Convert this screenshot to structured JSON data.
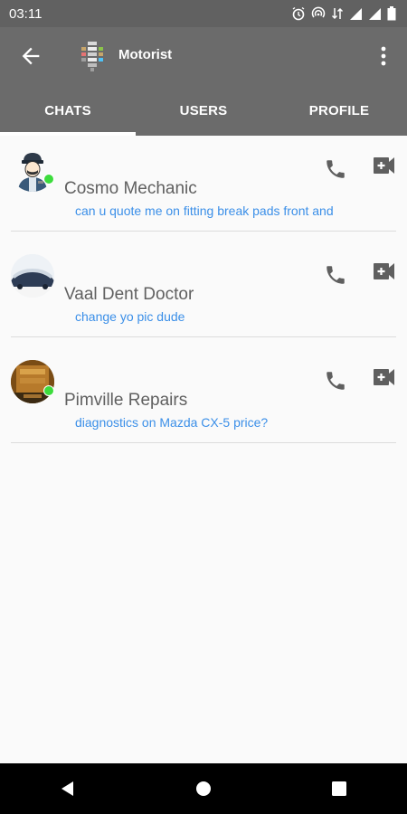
{
  "status_bar": {
    "time": "03:11",
    "icons": [
      "alarm-icon",
      "hotspot-icon",
      "data-icon",
      "signal-icon",
      "signal-icon",
      "battery-icon"
    ]
  },
  "app_bar": {
    "title": "Motorist",
    "back_icon": "arrow-back-icon",
    "menu_icon": "more-vert-icon"
  },
  "tabs": [
    {
      "label": "CHATS",
      "selected": true
    },
    {
      "label": "USERS",
      "selected": false
    },
    {
      "label": "PROFILE",
      "selected": false
    }
  ],
  "chats": [
    {
      "name": "Cosmo Mechanic",
      "preview": "can u quote me on fitting break pads front and",
      "online": true
    },
    {
      "name": "Vaal Dent Doctor",
      "preview": "change yo pic dude",
      "online": false
    },
    {
      "name": "Pimville Repairs",
      "preview": "diagnostics on Mazda CX-5 price?",
      "online": true
    }
  ],
  "colors": {
    "app_bar": "#6b6b6b",
    "status_bar": "#616161",
    "preview_text": "#3b8fe8",
    "online": "#3ddc3d"
  }
}
